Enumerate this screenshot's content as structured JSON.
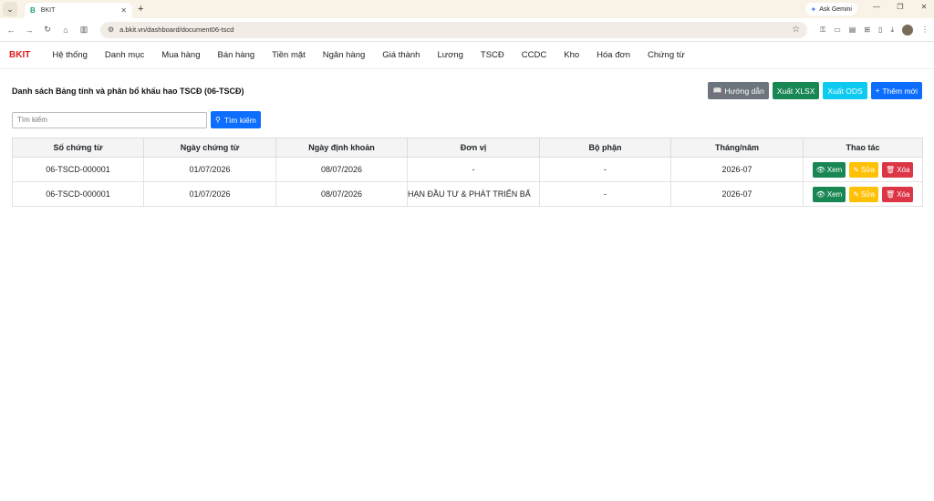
{
  "browser": {
    "tab_title": "BKIT",
    "tab_favicon": "B",
    "url": "a.bkit.vn/dashboard/document06-tscd",
    "gemini_label": "Ask Gemini"
  },
  "nav": {
    "brand": "BKIT",
    "items": [
      "Hệ thống",
      "Danh mục",
      "Mua hàng",
      "Bán hàng",
      "Tiền mặt",
      "Ngân hàng",
      "Giá thành",
      "Lương",
      "TSCĐ",
      "CCDC",
      "Kho",
      "Hóa đơn",
      "Chứng từ"
    ]
  },
  "page": {
    "title": "Danh sách Bảng tính và phân bổ khấu hao TSCĐ (06-TSCĐ)",
    "buttons": {
      "guide": "Hướng dẫn",
      "export_xlsx": "Xuất XLSX",
      "export_ods": "Xuất ODS",
      "add_new": "Thêm mới"
    },
    "search": {
      "placeholder": "Tìm kiếm",
      "button": "Tìm kiếm"
    }
  },
  "table": {
    "headers": [
      "Số chứng từ",
      "Ngày chứng từ",
      "Ngày định khoản",
      "Đơn vị",
      "Bộ phận",
      "Tháng/năm",
      "Thao tác"
    ],
    "rows": [
      {
        "doc_no": "06-TSCD-000001",
        "doc_date": "01/07/2026",
        "post_date": "08/07/2026",
        "unit": "-",
        "dept": "-",
        "period": "2026-07"
      },
      {
        "doc_no": "06-TSCD-000001",
        "doc_date": "01/07/2026",
        "post_date": "08/07/2026",
        "unit": "HẠN ĐẦU TƯ & PHÁT TRIỂN BẤ",
        "dept": "-",
        "period": "2026-07"
      }
    ],
    "action_labels": {
      "view": "Xem",
      "edit": "Sửa",
      "delete": "Xóa"
    }
  },
  "colors": {
    "brand": "#e41c1c",
    "primary": "#0d6efd",
    "success": "#198754",
    "info": "#0dcaf0",
    "warning": "#ffc107",
    "danger": "#dc3545",
    "secondary": "#6c757d"
  }
}
